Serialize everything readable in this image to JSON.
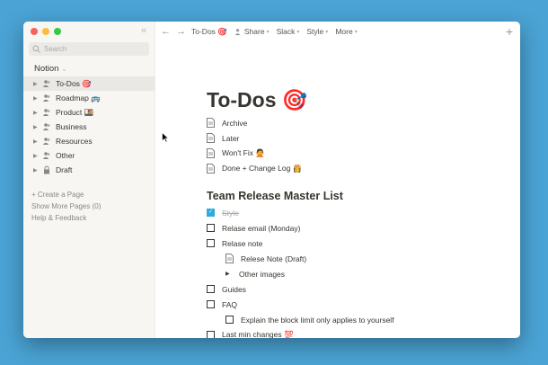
{
  "sidebar": {
    "search_placeholder": "Search",
    "workspace": "Notion",
    "items": [
      {
        "label": "To-Dos 🎯",
        "icon": "people-icon",
        "active": true
      },
      {
        "label": "Roadmap 🚌",
        "icon": "people-icon",
        "active": false
      },
      {
        "label": "Product 🍱",
        "icon": "people-icon",
        "active": false
      },
      {
        "label": "Business",
        "icon": "people-icon",
        "active": false
      },
      {
        "label": "Resources",
        "icon": "people-icon",
        "active": false
      },
      {
        "label": "Other",
        "icon": "people-icon",
        "active": false
      },
      {
        "label": "Draft",
        "icon": "lock-icon",
        "active": false
      }
    ],
    "create_page": "+ Create a Page",
    "show_more": "Show More Pages (0)",
    "help": "Help & Feedback"
  },
  "topbar": {
    "breadcrumb": "To-Dos 🎯",
    "share": "Share",
    "slack": "Slack",
    "style": "Style",
    "more": "More"
  },
  "page": {
    "title": "To-Dos 🎯",
    "links": [
      "Archive",
      "Later",
      "Won't Fix 🙅",
      "Done + Change Log 👸"
    ],
    "section_title": "Team Release Master List",
    "todos": {
      "style": "Style",
      "relase_email": "Relase email (Monday)",
      "relase_note": "Relase note",
      "relese_note_draft": "Relese Note (Draft)",
      "other_images": "Other images",
      "guides": "Guides",
      "faq": "FAQ",
      "explain": "Explain the block limit only applies to yourself",
      "last_min": "Last min changes 💯"
    }
  },
  "colors": {
    "accent": "#2eaadc",
    "background": "#4aa3d4",
    "sidebar": "#f7f6f3"
  }
}
